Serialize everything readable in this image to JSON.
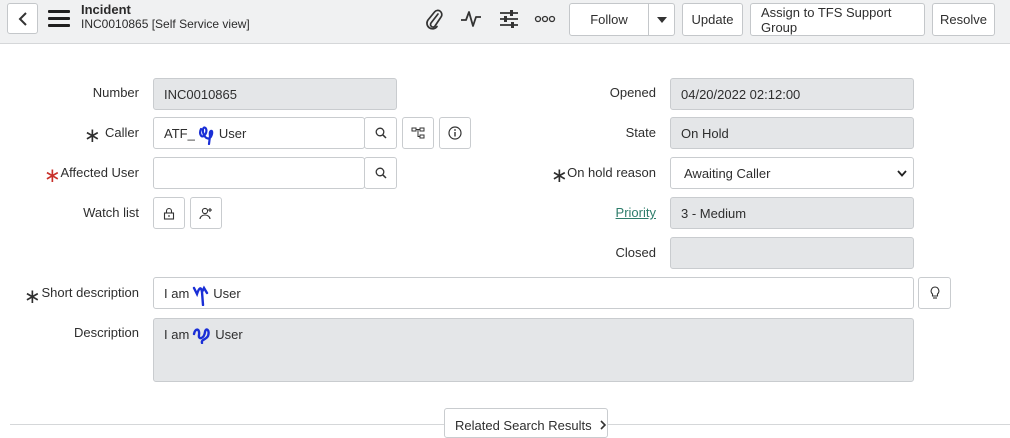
{
  "header": {
    "title": "Incident",
    "subtitle": "INC0010865 [Self Service view]",
    "icons": [
      "back-icon",
      "menu-icon",
      "paperclip-icon",
      "activity-icon",
      "settings-sliders-icon",
      "more-icon"
    ],
    "buttons": {
      "follow": "Follow",
      "update": "Update",
      "assign": "Assign to TFS Support Group",
      "resolve": "Resolve"
    }
  },
  "form": {
    "number": {
      "label": "Number",
      "value": "INC0010865"
    },
    "caller": {
      "label": "Caller",
      "value_prefix": "ATF_",
      "value_suffix": "User",
      "mandatory": true
    },
    "affected_user": {
      "label": "Affected User",
      "value": "",
      "mandatory": true,
      "mandatory_color": "#c8302a"
    },
    "watch_list": {
      "label": "Watch list"
    },
    "opened": {
      "label": "Opened",
      "value": "04/20/2022 02:12:00"
    },
    "state": {
      "label": "State",
      "value": "On Hold"
    },
    "on_hold_reason": {
      "label": "On hold reason",
      "value": "Awaiting Caller",
      "mandatory": true
    },
    "priority": {
      "label": "Priority",
      "value": "3 - Medium"
    },
    "closed": {
      "label": "Closed",
      "value": ""
    },
    "short_description": {
      "label": "Short description",
      "value_prefix": "I am",
      "value_suffix": "User",
      "mandatory": true
    },
    "description": {
      "label": "Description",
      "value_prefix": "I am",
      "value_suffix": "User"
    }
  },
  "related_search": {
    "label": "Related Search Results"
  },
  "colors": {
    "accent_link": "#2e7d6b",
    "readonly_bg": "#e4e6e8",
    "header_bg": "#f0f1f2",
    "scribble": "#1a2fd6"
  }
}
